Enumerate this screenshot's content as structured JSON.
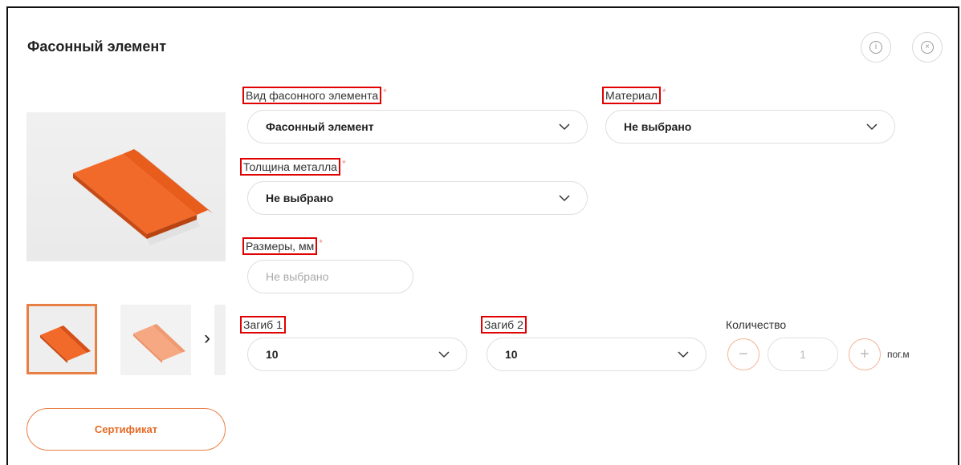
{
  "modal": {
    "title": "Фасонный элемент",
    "info_icon": "info-icon",
    "close_icon": "close-icon"
  },
  "gallery": {
    "thumbnails_count_visible": 2,
    "next_arrow": "›",
    "certificate_label": "Сертификат"
  },
  "fields": {
    "type": {
      "label": "Вид фасонного элемента",
      "required": "*",
      "value": "Фасонный элемент"
    },
    "material": {
      "label": "Материал",
      "required": "*",
      "value": "Не выбрано"
    },
    "thickness": {
      "label": "Толщина металла",
      "required": "*",
      "value": "Не выбрано"
    },
    "dimensions": {
      "label": "Размеры, мм",
      "required": "*",
      "placeholder": "Не выбрано"
    },
    "bend1": {
      "label": "Загиб 1",
      "value": "10"
    },
    "bend2": {
      "label": "Загиб 2",
      "value": "10"
    },
    "quantity": {
      "label": "Количество",
      "value": "1",
      "minus": "−",
      "plus": "+",
      "unit": "пог.м"
    }
  },
  "colors": {
    "accent": "#e87f45",
    "highlight_box": "#e10000",
    "product_orange": "#f26a2a"
  }
}
